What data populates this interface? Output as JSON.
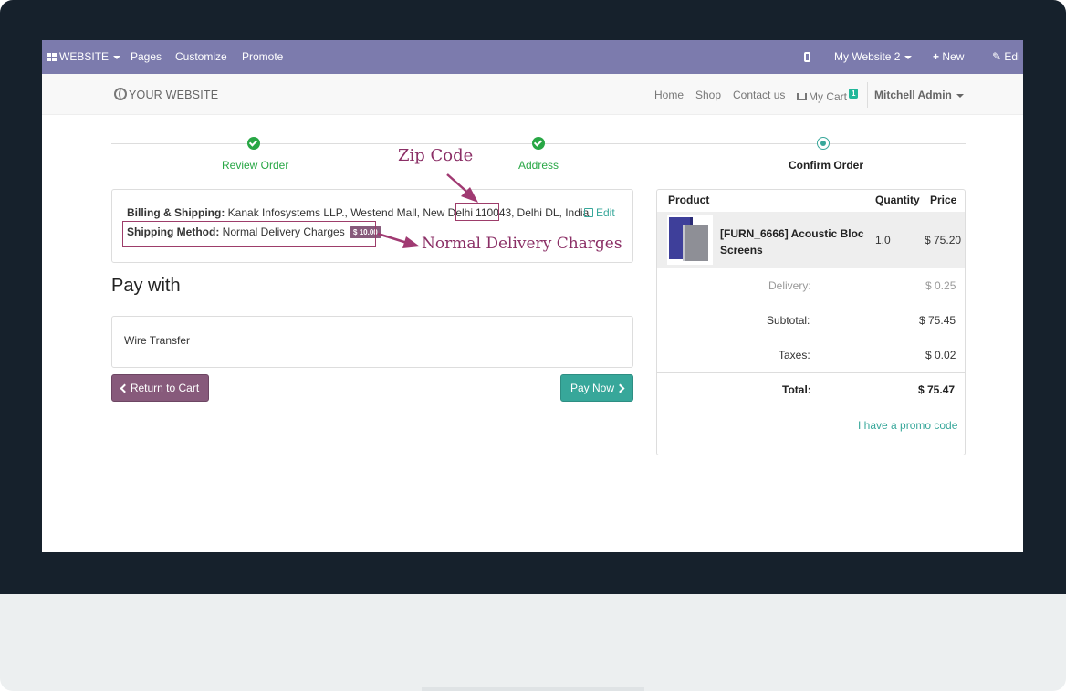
{
  "topbar": {
    "website_menu": "WEBSITE",
    "pages": "Pages",
    "customize": "Customize",
    "promote": "Promote",
    "website_selector": "My Website 2",
    "new_label": "New",
    "edit_label": "Edi"
  },
  "header": {
    "logo": "YOUR WEBSITE",
    "nav": [
      "Home",
      "Shop",
      "Contact us"
    ],
    "cart_label": "My Cart",
    "cart_count": "1",
    "user": "Mitchell Admin"
  },
  "wizard": {
    "steps": [
      {
        "label": "Review Order",
        "state": "done"
      },
      {
        "label": "Address",
        "state": "done"
      },
      {
        "label": "Confirm Order",
        "state": "current"
      }
    ]
  },
  "billing": {
    "label": "Billing & Shipping:",
    "address_before": "Kanak Infosystems LLP., Westend Mall, New Delhi",
    "zip": "110043,",
    "address_after": "Delhi DL, India",
    "edit_label": "Edit",
    "shipping_label": "Shipping Method:",
    "shipping_value": "Normal Delivery Charges",
    "shipping_price": "$ 10.00"
  },
  "annotations": {
    "zip_note": "Zip Code",
    "delivery_note": "Normal  Delivery  Charges"
  },
  "payment": {
    "title": "Pay with",
    "option": "Wire Transfer",
    "return_label": "Return to Cart",
    "pay_label": "Pay Now"
  },
  "summary": {
    "headers": {
      "product": "Product",
      "quantity": "Quantity",
      "price": "Price"
    },
    "product": {
      "name": "[FURN_6666] Acoustic Bloc Screens",
      "quantity": "1.0",
      "price": "$ 75.20"
    },
    "delivery_label": "Delivery:",
    "delivery_value": "$ 0.25",
    "subtotal_label": "Subtotal:",
    "subtotal_value": "$ 75.45",
    "taxes_label": "Taxes:",
    "taxes_value": "$ 0.02",
    "total_label": "Total:",
    "total_value": "$ 75.47",
    "promo_label": "I have a promo code"
  },
  "colors": {
    "odoo_bar": "#7c7bad",
    "primary": "#875a7b",
    "accent": "#37a79a",
    "success": "#28a745",
    "annotation": "#8b2f66"
  }
}
